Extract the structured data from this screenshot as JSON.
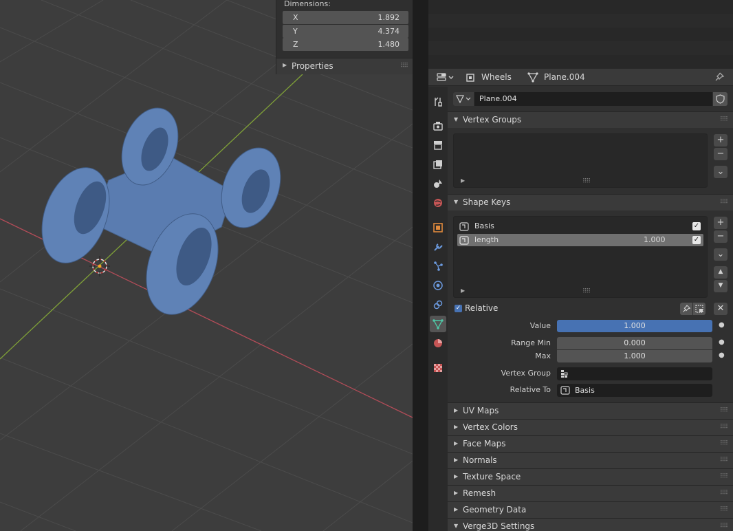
{
  "npanel": {
    "dimensions_title": "Dimensions:",
    "dims": [
      {
        "axis": "X",
        "value": "1.892"
      },
      {
        "axis": "Y",
        "value": "4.374"
      },
      {
        "axis": "Z",
        "value": "1.480"
      }
    ],
    "properties_label": "Properties"
  },
  "header": {
    "object_name": "Wheels",
    "mesh_name": "Plane.004"
  },
  "datablock": {
    "name": "Plane.004"
  },
  "panels": {
    "vertex_groups": "Vertex Groups",
    "shape_keys": "Shape Keys",
    "collapsed": [
      "UV Maps",
      "Vertex Colors",
      "Face Maps",
      "Normals",
      "Texture Space",
      "Remesh",
      "Geometry Data"
    ],
    "verge3d": "Verge3D Settings"
  },
  "shape_keys": {
    "items": [
      {
        "name": "Basis",
        "value": "",
        "checked": true
      },
      {
        "name": "length",
        "value": "1.000",
        "checked": true
      }
    ],
    "relative_label": "Relative",
    "value_label": "Value",
    "value": "1.000",
    "range_min_label": "Range Min",
    "range_min": "0.000",
    "max_label": "Max",
    "max": "1.000",
    "vertex_group_label": "Vertex Group",
    "vertex_group_value": "",
    "relative_to_label": "Relative To",
    "relative_to_value": "Basis"
  },
  "colors": {
    "accent_blue": "#4772b3",
    "mesh_blue": "#5a7cb0",
    "x_axis": "#b34c58",
    "y_axis": "#7fa038",
    "grid": "#4a4a4a",
    "background": "#3d3d3d"
  },
  "icons": {
    "editor_type": "properties-editor-icon",
    "object": "object-icon",
    "mesh": "mesh-data-icon",
    "pin": "pin-icon",
    "tabs": [
      "tool-icon",
      "render-icon",
      "output-icon",
      "view-layer-icon",
      "scene-icon",
      "world-icon",
      "object-icon",
      "modifier-icon",
      "particles-icon",
      "physics-icon",
      "constraints-icon",
      "data-icon",
      "material-icon",
      "texture-icon"
    ]
  }
}
